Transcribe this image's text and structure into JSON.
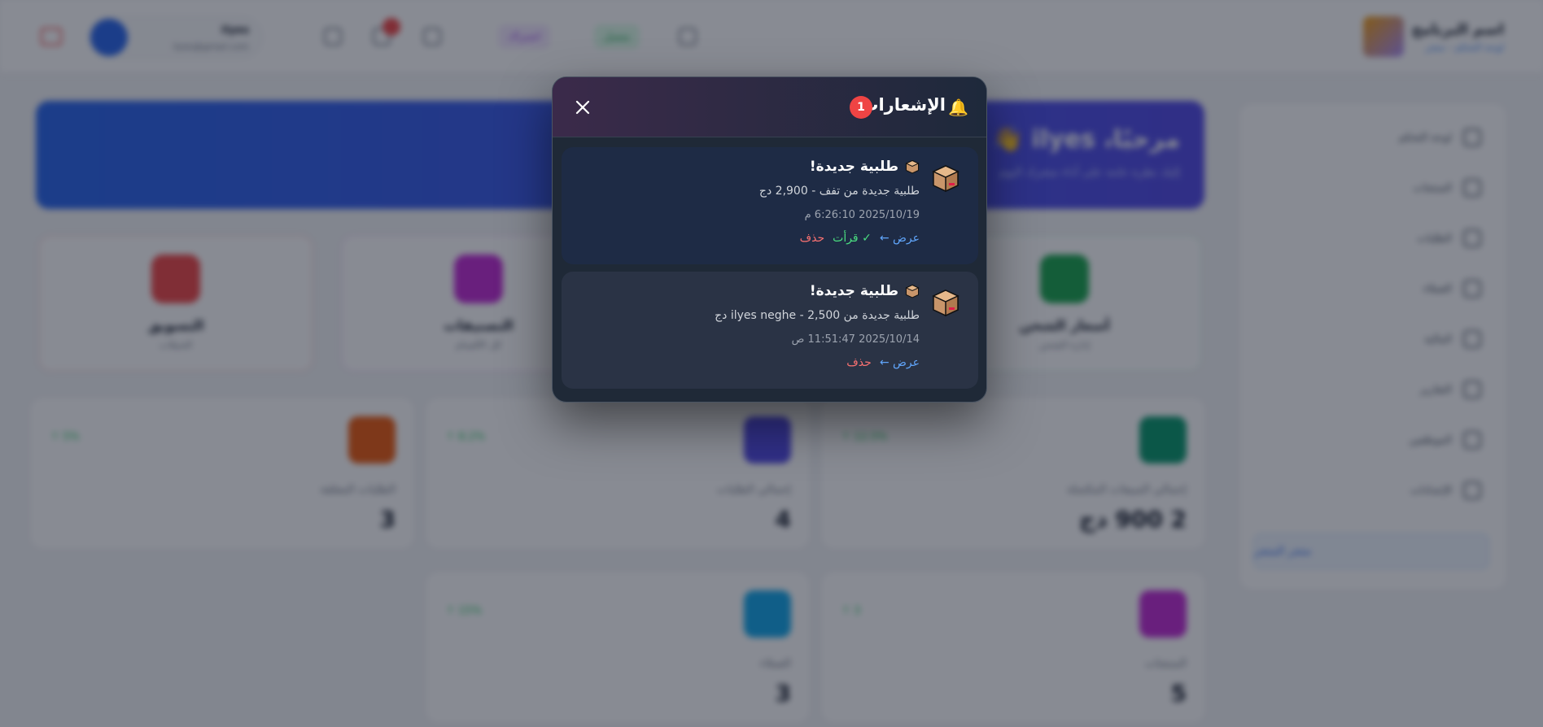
{
  "background": {
    "brand": {
      "name": "اسم البرنامج",
      "subtitle": "لوحة التحكم - متجر"
    },
    "topbar": {
      "status_chip": "متصل",
      "plan_chip": "اشتراك",
      "user_name": "ilyes",
      "user_email": "ilyes@gmail.com",
      "cart_label": "السلة"
    },
    "sidebar": {
      "items": [
        "لوحة التحكم",
        "المنتجات",
        "الطلبات",
        "العملاء",
        "المالية",
        "التقارير",
        "الموظفين",
        "الإعدادات"
      ],
      "cta": "متجر المتجر"
    },
    "hero": {
      "title": "مرحبًا، ilyes 👋",
      "subtitle": "إليك نظرة عامة على أداء متجرك اليوم"
    },
    "quick_actions": [
      {
        "title": "أسعار الشحن",
        "subtitle": "إدارة الشحن",
        "color": "#16a34a"
      },
      {
        "title": "التصنيفات",
        "subtitle": "كل الأقسام",
        "color": "#c026d3"
      },
      {
        "title": "التسويق",
        "subtitle": "الحملات",
        "color": "#ef4444"
      }
    ],
    "stats": [
      {
        "label": "إجمالي المبيعات المكتملة",
        "value": "2 900 دج",
        "trend": "12.5% ↑",
        "color": "#059669"
      },
      {
        "label": "إجمالي الطلبات",
        "value": "4",
        "trend": "8.2% ↑",
        "color": "#4f46e5"
      },
      {
        "label": "الطلبات المعلقة",
        "value": "3",
        "trend": "5% ↑",
        "color": "#ea580c"
      },
      {
        "label": "المنتجات",
        "value": "5",
        "trend": "3 ↑",
        "color": "#c026d3"
      },
      {
        "label": "العملاء",
        "value": "3",
        "trend": "15% ↑",
        "color": "#0ea5e9"
      }
    ]
  },
  "modal": {
    "title": "الإشعارات",
    "unread_count": "1",
    "notifications": [
      {
        "title": "طلبية جديدة!",
        "body": "طلبية جديدة من تفف - 2,900 دج",
        "time": "2025/10/19 6:26:10 م",
        "view_label": "عرض ←",
        "mark_read_label": "✓ قرأت",
        "delete_label": "حذف",
        "unread": true
      },
      {
        "title": "طلبية جديدة!",
        "body": "طلبية جديدة من ilyes neghe - 2,500 دج",
        "time": "2025/10/14 11:51:47 ص",
        "view_label": "عرض ←",
        "delete_label": "حذف",
        "unread": false
      }
    ]
  },
  "colors": {
    "accent_red": "#ef4444",
    "link_blue": "#60a5fa",
    "read_green": "#4ade80",
    "delete_red": "#f87171",
    "bell_yellow": "#fbbf24"
  }
}
